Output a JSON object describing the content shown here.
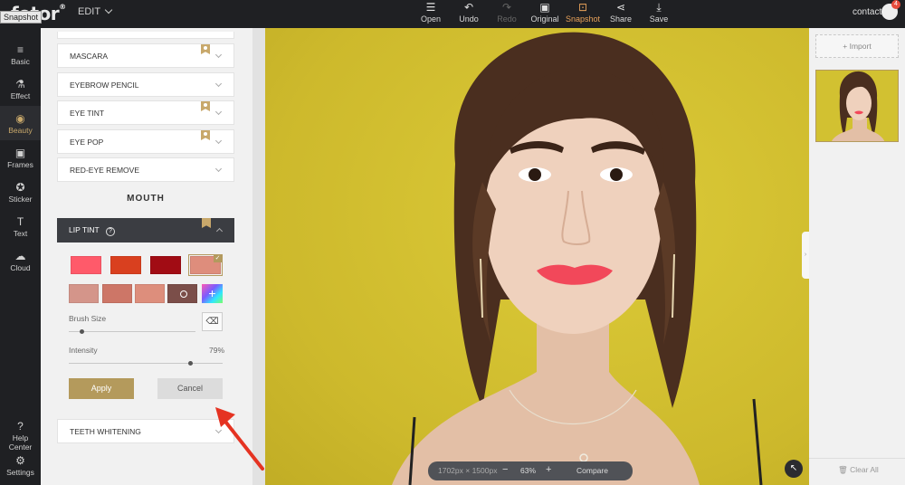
{
  "app": {
    "logo_text": "fotor",
    "tooltip": "Snapshot",
    "menu_label": "EDIT"
  },
  "toolbar": {
    "items": [
      {
        "label": "Open",
        "icon": "menu-icon",
        "glyph": "☰",
        "state": "normal"
      },
      {
        "label": "Undo",
        "icon": "undo-icon",
        "glyph": "↶",
        "state": "normal"
      },
      {
        "label": "Redo",
        "icon": "redo-icon",
        "glyph": "↷",
        "state": "disabled"
      },
      {
        "label": "Original",
        "icon": "original-icon",
        "glyph": "▣",
        "state": "normal"
      },
      {
        "label": "Snapshot",
        "icon": "snapshot-icon",
        "glyph": "⊡",
        "state": "active"
      },
      {
        "label": "Share",
        "icon": "share-icon",
        "glyph": "⋖",
        "state": "normal"
      },
      {
        "label": "Save",
        "icon": "save-icon",
        "glyph": "⤓",
        "state": "normal"
      }
    ],
    "active_color": "#e8a25a"
  },
  "user": {
    "name": "contact",
    "badge_count": "4"
  },
  "sidebar": {
    "items": [
      {
        "label": "Basic",
        "icon": "sliders-icon",
        "glyph": "≡"
      },
      {
        "label": "Effect",
        "icon": "flask-icon",
        "glyph": "⚗"
      },
      {
        "label": "Beauty",
        "icon": "eye-icon",
        "glyph": "◉"
      },
      {
        "label": "Frames",
        "icon": "frame-icon",
        "glyph": "▣"
      },
      {
        "label": "Sticker",
        "icon": "sticker-icon",
        "glyph": "✪"
      },
      {
        "label": "Text",
        "icon": "text-icon",
        "glyph": "T"
      },
      {
        "label": "Cloud",
        "icon": "cloud-icon",
        "glyph": "☁"
      }
    ],
    "bottom_items": [
      {
        "label": "Help Center",
        "icon": "help-icon",
        "glyph": "?"
      },
      {
        "label": "Settings",
        "icon": "gear-icon",
        "glyph": "⚙"
      }
    ],
    "active_color": "#c8a86b"
  },
  "beauty_panel": {
    "accordions": [
      {
        "label": "MASCARA",
        "premium": true
      },
      {
        "label": "EYEBROW PENCIL",
        "premium": false
      },
      {
        "label": "EYE TINT",
        "premium": true
      },
      {
        "label": "EYE POP",
        "premium": true
      },
      {
        "label": "RED-EYE REMOVE",
        "premium": false
      }
    ],
    "section_title": "MOUTH",
    "lip_tint": {
      "label": "LIP TINT",
      "help_glyph": "?",
      "swatches": [
        {
          "color": "#ff5a6a",
          "selected": false
        },
        {
          "color": "#d9401f",
          "selected": false
        },
        {
          "color": "#a10c14",
          "selected": false
        },
        {
          "color": "#de8d7c",
          "selected": true
        },
        {
          "color": "#d4958a",
          "selected": false
        },
        {
          "color": "#cd7667",
          "selected": false
        },
        {
          "color": "#dd8e7c",
          "selected": false
        },
        {
          "color": "#7b4e49",
          "selected": false
        }
      ],
      "add_glyph": "+",
      "brush_size_label": "Brush Size",
      "brush_size_value": 0.1,
      "intensity_label": "Intensity",
      "intensity_value": "79%",
      "intensity_fraction": 0.79,
      "apply_label": "Apply",
      "cancel_label": "Cancel"
    },
    "teeth_whitening_label": "TEETH WHITENING"
  },
  "canvas": {
    "dimensions_text": "1702px × 1500px",
    "zoom_minus": "−",
    "zoom_value": "63%",
    "zoom_plus": "+",
    "compare_label": "Compare"
  },
  "right_panel": {
    "import_label": "Import",
    "clear_all_label": "Clear All"
  }
}
